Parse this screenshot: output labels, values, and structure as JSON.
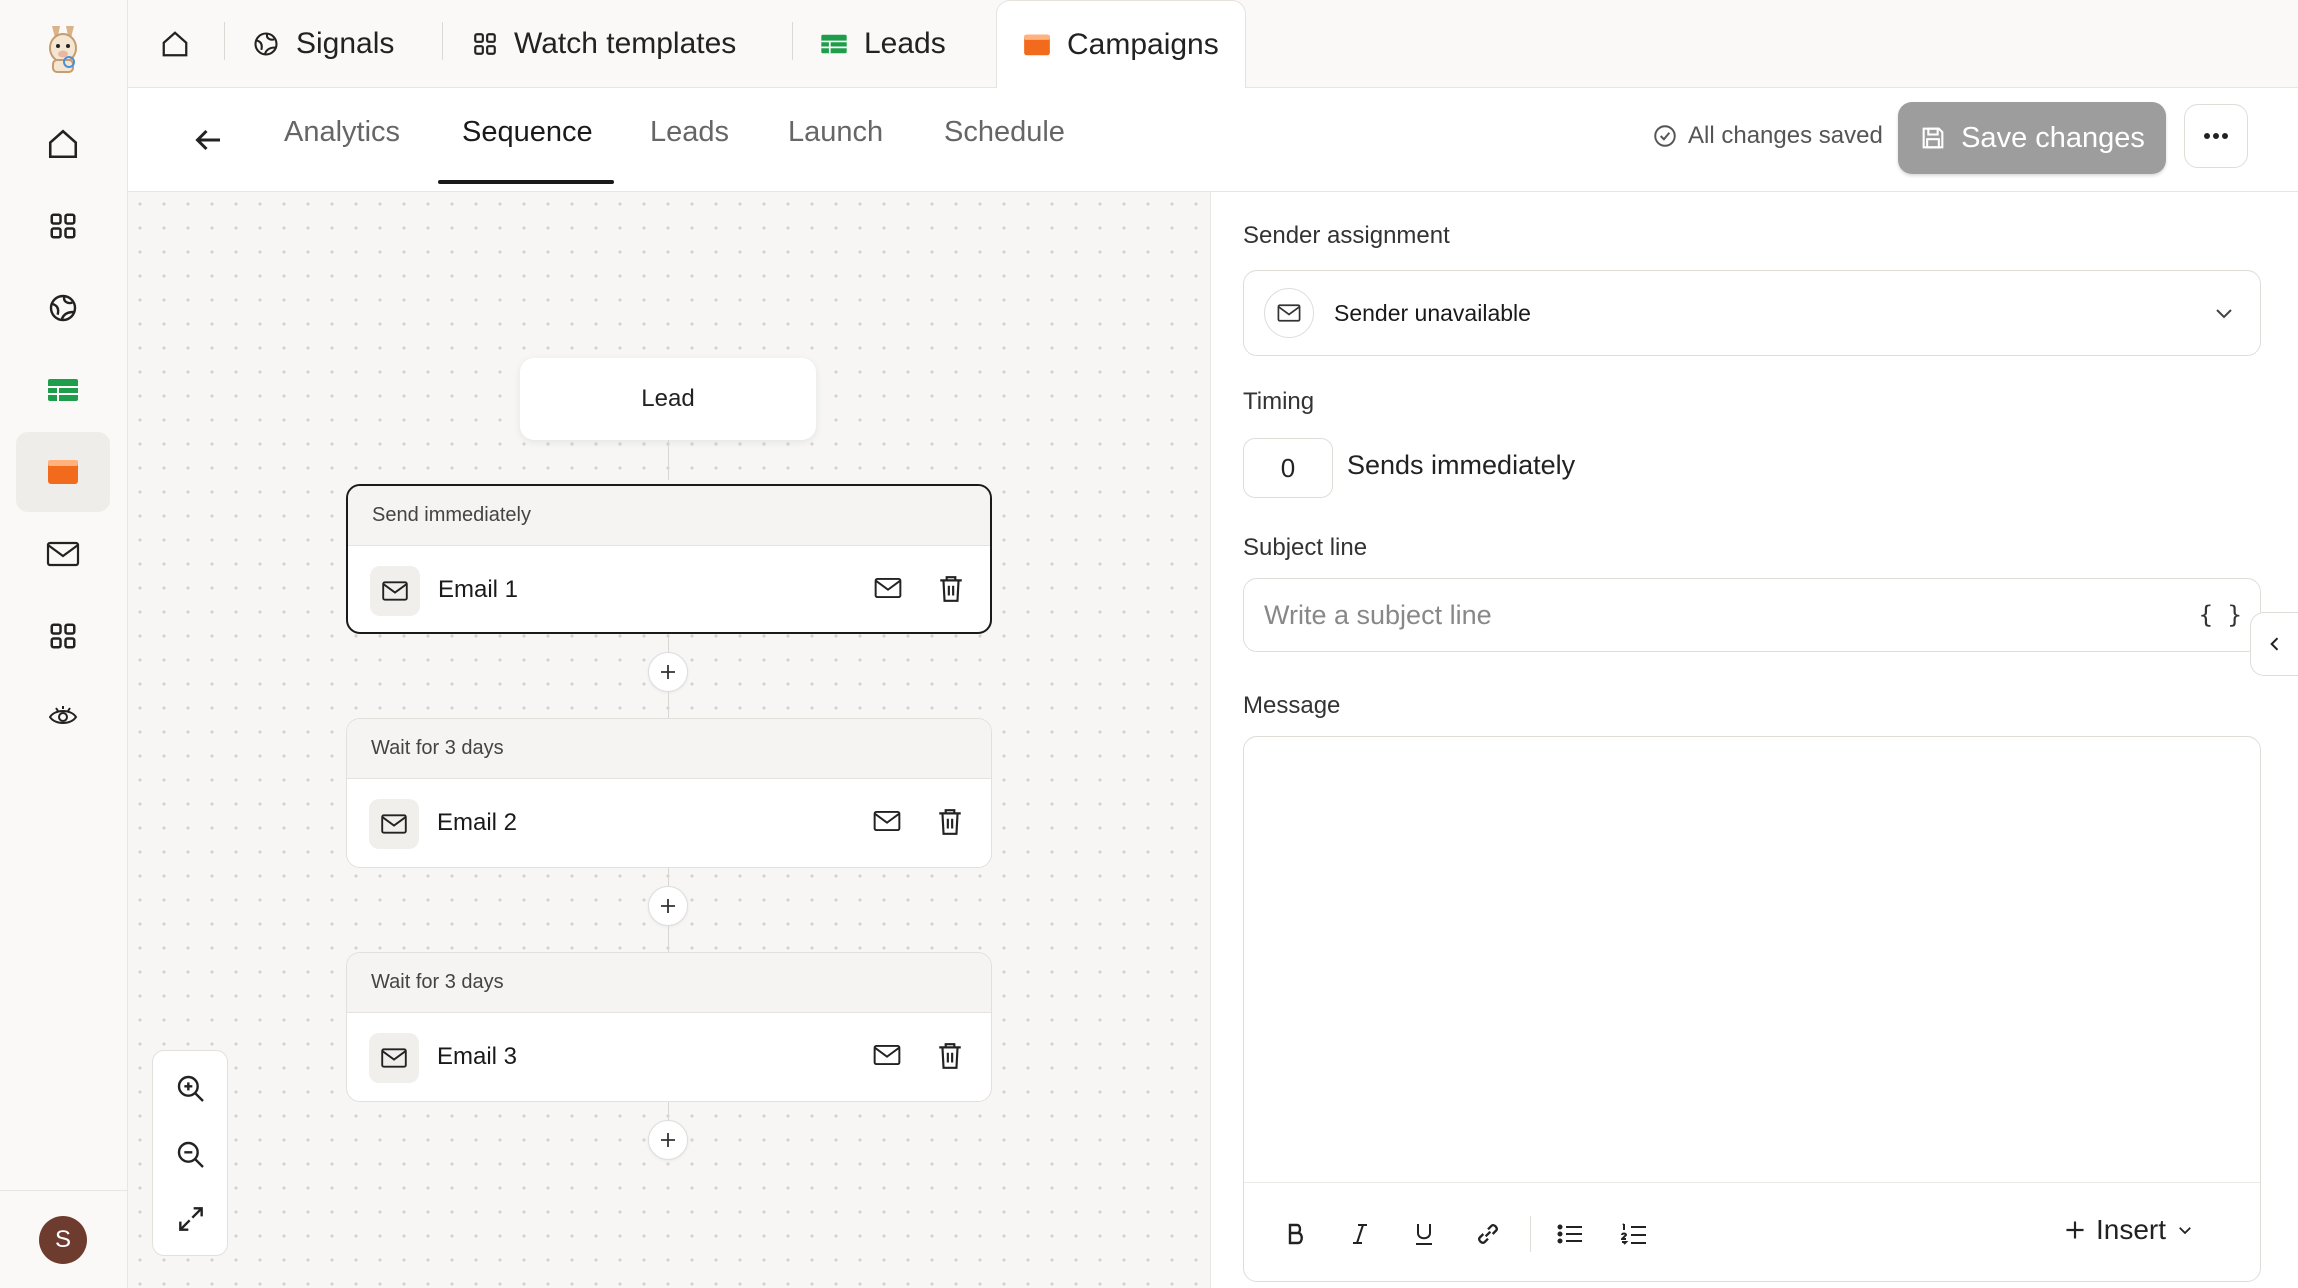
{
  "sidebar": {
    "logo": "llama-logo-icon",
    "items": [
      {
        "icon": "home-icon"
      },
      {
        "icon": "grid-icon"
      },
      {
        "icon": "globe-icon"
      },
      {
        "icon": "table-icon",
        "color": "#1e9e4a"
      },
      {
        "icon": "campaign-icon",
        "color": "#f26b1d"
      },
      {
        "icon": "mail-icon"
      },
      {
        "icon": "apps-icon"
      },
      {
        "icon": "eye-icon"
      }
    ],
    "avatar_initial": "S",
    "avatar_color": "#6e3c2f"
  },
  "top_tabs": {
    "home_icon": "home-icon",
    "tabs": [
      {
        "label": "Signals",
        "icon": "globe-icon"
      },
      {
        "label": "Watch templates",
        "icon": "grid-icon"
      },
      {
        "label": "Leads",
        "icon": "table-icon",
        "color": "#1e9e4a"
      },
      {
        "label": "Campaigns",
        "icon": "campaign-icon",
        "color": "#f26b1d",
        "active": true
      }
    ]
  },
  "subnav": {
    "tabs": [
      "Analytics",
      "Sequence",
      "Leads",
      "Launch",
      "Schedule"
    ],
    "active_tab": "Sequence",
    "save_status": "All changes saved",
    "save_button": "Save changes",
    "more_icon": "more-horizontal-icon"
  },
  "canvas": {
    "lead_node": "Lead",
    "steps": [
      {
        "header": "Send immediately",
        "name": "Email 1",
        "selected": true
      },
      {
        "header": "Wait for  3 days",
        "name": "Email 2",
        "selected": false
      },
      {
        "header": "Wait for  3 days",
        "name": "Email 3",
        "selected": false
      }
    ],
    "zoom_controls": [
      "zoom-in-icon",
      "zoom-out-icon",
      "fit-view-icon"
    ]
  },
  "panel": {
    "sender_label": "Sender assignment",
    "sender_value": "Sender unavailable",
    "timing_label": "Timing",
    "timing_value": "0",
    "timing_text": "Sends immediately",
    "subject_label": "Subject line",
    "subject_placeholder": "Write a subject line",
    "subject_value": "",
    "variables_button": "{ }",
    "message_label": "Message",
    "toolbar": [
      "bold-icon",
      "italic-icon",
      "underline-icon",
      "link-icon",
      "bullet-list-icon",
      "numbered-list-icon"
    ],
    "insert_button": "Insert"
  },
  "colors": {
    "accent_dark": "#1a1a1a",
    "save_button_bg": "#9d9d9d",
    "leads_green": "#1e9e4a",
    "campaigns_orange": "#f26b1d"
  }
}
